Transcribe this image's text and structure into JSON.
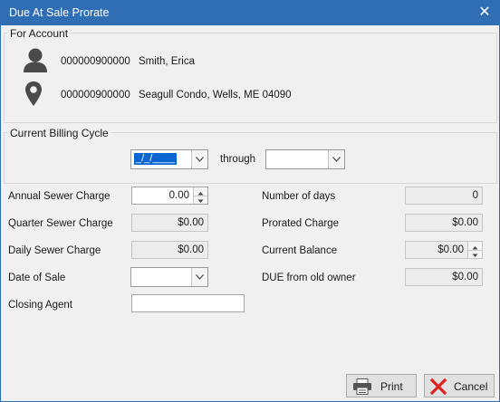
{
  "window": {
    "title": "Due At Sale Prorate",
    "close_symbol": "✕"
  },
  "account": {
    "group_label": "For Account",
    "owner_number": "000000900000",
    "owner_name": "Smith, Erica",
    "location_number": "000000900000",
    "location_address": "Seagull Condo, Wells, ME 04090"
  },
  "billing": {
    "group_label": "Current Billing Cycle",
    "start_value": "_/_/____",
    "through_label": "through",
    "end_value": ""
  },
  "fields": {
    "annual_sewer_charge": {
      "label": "Annual Sewer Charge",
      "value": "0.00"
    },
    "quarter_sewer_charge": {
      "label": "Quarter Sewer Charge",
      "value": "$0.00"
    },
    "daily_sewer_charge": {
      "label": "Daily Sewer Charge",
      "value": "$0.00"
    },
    "date_of_sale": {
      "label": "Date of Sale",
      "value": ""
    },
    "closing_agent": {
      "label": "Closing Agent",
      "value": ""
    },
    "number_of_days": {
      "label": "Number of days",
      "value": "0"
    },
    "prorated_charge": {
      "label": "Prorated Charge",
      "value": "$0.00"
    },
    "current_balance": {
      "label": "Current Balance",
      "value": "$0.00"
    },
    "due_from_old_owner": {
      "label": "DUE from old owner",
      "value": "$0.00"
    }
  },
  "buttons": {
    "print": "Print",
    "cancel": "Cancel"
  },
  "colors": {
    "title_bar": "#2f6db5",
    "selection": "#0a64d2",
    "cancel_x": "#e02020"
  }
}
